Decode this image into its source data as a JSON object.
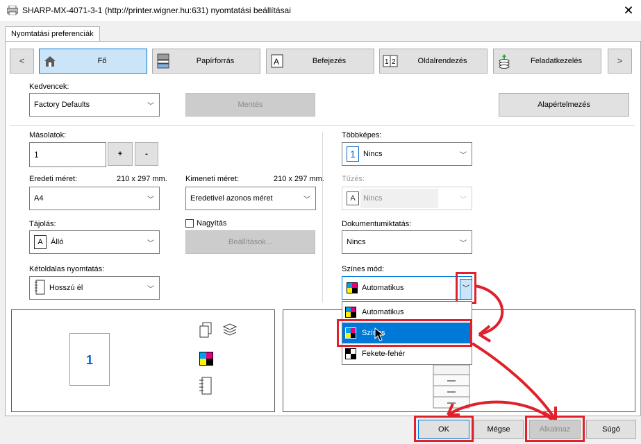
{
  "window": {
    "title": "SHARP-MX-4071-3-1 (http://printer.wigner.hu:631) nyomtatási beállításai",
    "close_glyph": "✕"
  },
  "tab": {
    "label": "Nyomtatási preferenciák"
  },
  "nav": {
    "prev": "<",
    "next": ">",
    "buttons": [
      {
        "label": "Fő",
        "icon": "home-icon"
      },
      {
        "label": "Papírforrás",
        "icon": "printer-tray-icon"
      },
      {
        "label": "Befejezés",
        "icon": "page-finish-icon"
      },
      {
        "label": "Oldalrendezés",
        "icon": "pages-layout-icon"
      },
      {
        "label": "Feladatkezelés",
        "icon": "job-stack-icon"
      }
    ]
  },
  "favorites": {
    "label": "Kedvencek:",
    "value": "Factory Defaults",
    "save": "Mentés",
    "defaults": "Alapértelmezés"
  },
  "copies": {
    "label": "Másolatok:",
    "value": "1",
    "plus": "+",
    "minus": "-"
  },
  "original_size": {
    "label": "Eredeti méret:",
    "dim": "210 x 297 mm.",
    "value": "A4"
  },
  "output_size": {
    "label": "Kimeneti méret:",
    "dim": "210 x 297 mm.",
    "value": "Eredetivel azonos méret"
  },
  "orientation": {
    "label": "Tájolás:",
    "value": "Álló",
    "icon_letter": "A"
  },
  "zoom": {
    "label": "Nagyítás",
    "checked": false,
    "settings": "Beállítások..."
  },
  "duplex": {
    "label": "Kétoldalas nyomtatás:",
    "value": "Hosszú él"
  },
  "multi": {
    "label": "Többképes:",
    "value": "Nincs",
    "icon_number": "1"
  },
  "staple": {
    "label": "Tűzés:",
    "value": "Nincs",
    "icon_letter": "A"
  },
  "filing": {
    "label": "Dokumentumiktatás:",
    "value": "Nincs"
  },
  "color_mode": {
    "label": "Színes mód:",
    "value": "Automatikus",
    "options": [
      "Automatikus",
      "Színes",
      "Fekete-fehér"
    ],
    "highlighted": "Színes"
  },
  "preview": {
    "page_number": "1"
  },
  "footer": {
    "ok": "OK",
    "cancel": "Mégse",
    "apply": "Alkalmaz",
    "help": "Súgó"
  },
  "colors": {
    "accent": "#0078d7",
    "annotation_red": "#e0202a",
    "cyan": "#00a0e9",
    "magenta": "#e4007f",
    "yellow": "#fff100",
    "black": "#000000"
  }
}
